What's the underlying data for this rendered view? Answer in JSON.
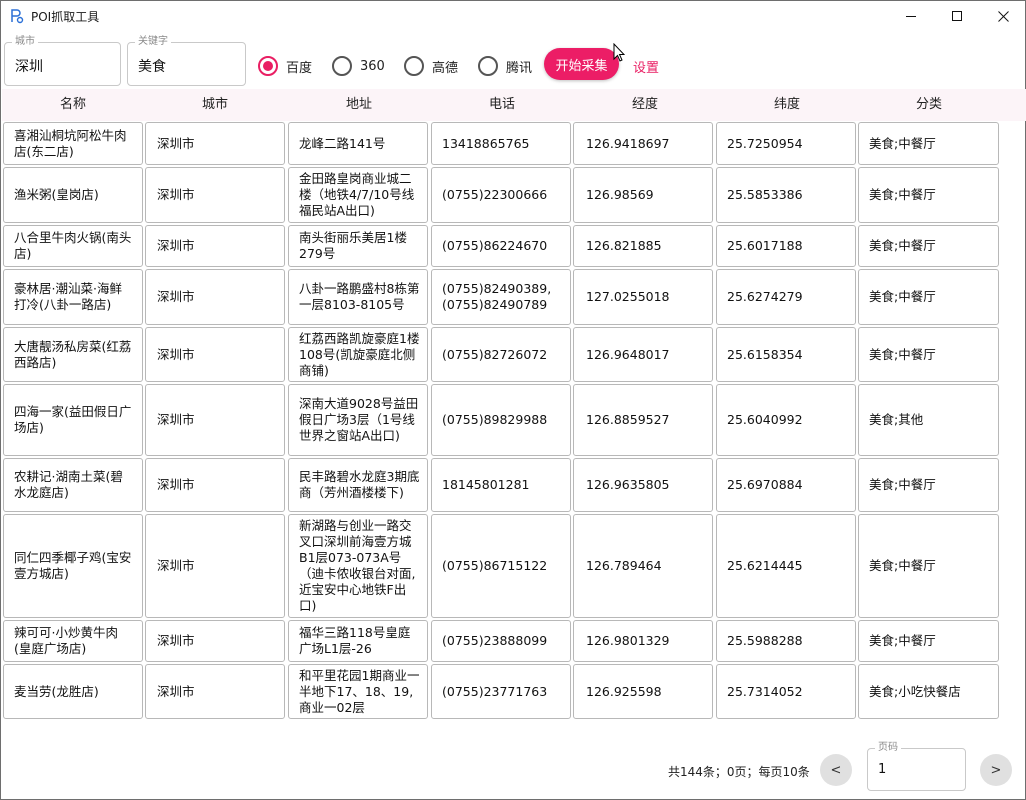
{
  "window": {
    "title": "POI抓取工具",
    "icon": "app-logo-icon",
    "controls": [
      "minimize-icon",
      "maximize-icon",
      "close-icon"
    ]
  },
  "toolbar": {
    "city": {
      "label": "城市",
      "value": "深圳"
    },
    "keyword": {
      "label": "关键字",
      "value": "美食"
    },
    "sources": [
      {
        "label": "百度",
        "checked": true
      },
      {
        "label": "360",
        "checked": false
      },
      {
        "label": "高德",
        "checked": false
      },
      {
        "label": "腾讯",
        "checked": false
      }
    ],
    "start_label": "开始采集",
    "settings_label": "设置",
    "accent_color": "#ec1d66"
  },
  "table": {
    "columns": [
      "名称",
      "城市",
      "地址",
      "电话",
      "经度",
      "纬度",
      "分类"
    ],
    "rows": [
      [
        "喜湘汕桐坑阿松牛肉店(东二店)",
        "深圳市",
        "龙峰二路141号",
        "13418865765",
        "126.9418697",
        "25.7250954",
        "美食;中餐厅"
      ],
      [
        "渔米粥(皇岗店)",
        "深圳市",
        "金田路皇岗商业城二楼（地铁4/7/10号线福民站A出口)",
        "(0755)22300666",
        "126.98569",
        "25.5853386",
        "美食;中餐厅"
      ],
      [
        "八合里牛肉火锅(南头店)",
        "深圳市",
        "南头街丽乐美居1楼279号",
        "(0755)86224670",
        "126.821885",
        "25.6017188",
        "美食;中餐厅"
      ],
      [
        "豪林居·潮汕菜·海鲜打冷(八卦一路店)",
        "深圳市",
        "八卦一路鹏盛村8栋第一层8103-8105号",
        "(0755)82490389,(0755)82490789",
        "127.0255018",
        "25.6274279",
        "美食;中餐厅"
      ],
      [
        "大唐靓汤私房菜(红荔西路店)",
        "深圳市",
        "红荔西路凯旋豪庭1楼108号(凯旋豪庭北侧商铺)",
        "(0755)82726072",
        "126.9648017",
        "25.6158354",
        "美食;中餐厅"
      ],
      [
        "四海一家(益田假日广场店)",
        "深圳市",
        "深南大道9028号益田假日广场3层（1号线世界之窗站A出口)",
        "(0755)89829988",
        "126.8859527",
        "25.6040992",
        "美食;其他"
      ],
      [
        "农耕记·湖南土菜(碧水龙庭店)",
        "深圳市",
        "民丰路碧水龙庭3期底商（芳州酒楼楼下)",
        "18145801281",
        "126.9635805",
        "25.6970884",
        "美食;中餐厅"
      ],
      [
        "同仁四季椰子鸡(宝安壹方城店)",
        "深圳市",
        "新湖路与创业一路交叉口深圳前海壹方城B1层073-073A号（迪卡侬收银台对面,近宝安中心地铁F出口)",
        "(0755)86715122",
        "126.789464",
        "25.6214445",
        "美食;中餐厅"
      ],
      [
        "辣可可·小炒黄牛肉(皇庭广场店)",
        "深圳市",
        "福华三路118号皇庭广场L1层-26",
        "(0755)23888099",
        "126.9801329",
        "25.5988288",
        "美食;中餐厅"
      ],
      [
        "麦当劳(龙胜店)",
        "深圳市",
        "和平里花园1期商业一半地下17、18、19,商业一02层",
        "(0755)23771763",
        "126.925598",
        "25.7314052",
        "美食;小吃快餐店"
      ]
    ]
  },
  "pager": {
    "summary": "共144条；0页；每页10条",
    "page_label": "页码",
    "page_value": "1",
    "prev_label": "<",
    "next_label": ">"
  }
}
